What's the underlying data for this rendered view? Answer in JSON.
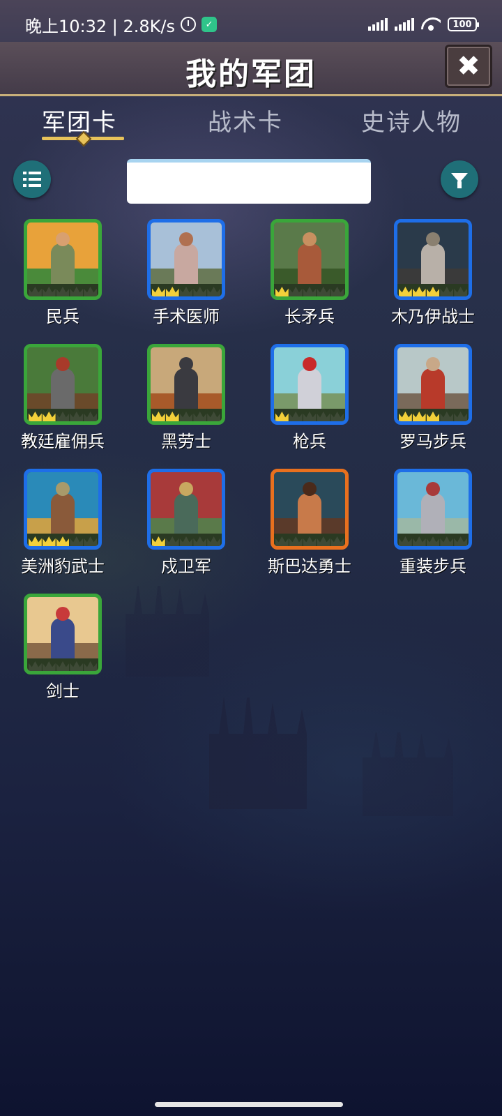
{
  "status_bar": {
    "time": "晚上10:32 | 2.8K/s",
    "battery": "100",
    "icons": [
      "alarm-icon",
      "shield-badge-icon",
      "signal-icon",
      "signal-icon",
      "wifi-icon",
      "battery-icon"
    ]
  },
  "header": {
    "title": "我的军团",
    "close_icon": "close-icon"
  },
  "tabs": [
    {
      "label": "军团卡",
      "active": true
    },
    {
      "label": "战术卡",
      "active": false
    },
    {
      "label": "史诗人物",
      "active": false
    }
  ],
  "toolbar": {
    "list_icon": "list-icon",
    "filter_icon": "filter-icon",
    "search_value": "",
    "search_placeholder": ""
  },
  "colors": {
    "rarity_green": "#3aa63a",
    "rarity_blue": "#1e6ee8",
    "rarity_orange": "#e8701e",
    "crown_gold": "#f2d03a",
    "tab_accent": "#e8c35a",
    "button_teal": "#1f6f78"
  },
  "units": [
    {
      "name": "民兵",
      "rarity": "green",
      "crowns": 0
    },
    {
      "name": "手术医师",
      "rarity": "blue",
      "crowns": 2
    },
    {
      "name": "长矛兵",
      "rarity": "green",
      "crowns": 1
    },
    {
      "name": "木乃伊战士",
      "rarity": "blue",
      "crowns": 3
    },
    {
      "name": "教廷雇佣兵",
      "rarity": "green",
      "crowns": 2
    },
    {
      "name": "黑劳士",
      "rarity": "green",
      "crowns": 2
    },
    {
      "name": "枪兵",
      "rarity": "blue",
      "crowns": 1
    },
    {
      "name": "罗马步兵",
      "rarity": "blue",
      "crowns": 3
    },
    {
      "name": "美洲豹武士",
      "rarity": "blue",
      "crowns": 3
    },
    {
      "name": "戍卫军",
      "rarity": "blue",
      "crowns": 1
    },
    {
      "name": "斯巴达勇士",
      "rarity": "orange",
      "crowns": 0
    },
    {
      "name": "重装步兵",
      "rarity": "blue",
      "crowns": 0
    },
    {
      "name": "剑士",
      "rarity": "green",
      "crowns": 0
    }
  ]
}
